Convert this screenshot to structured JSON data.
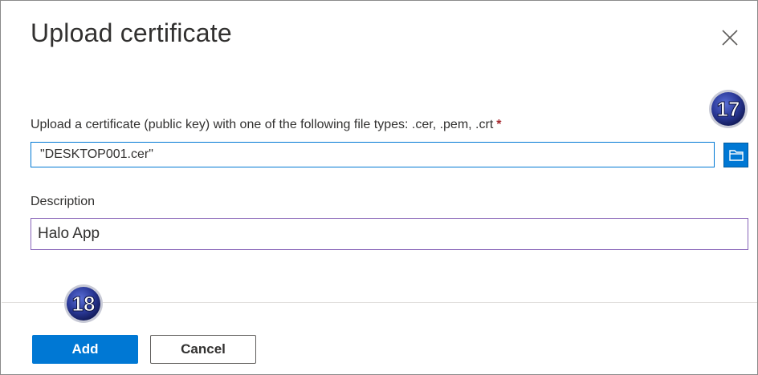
{
  "dialog": {
    "title": "Upload certificate"
  },
  "upload": {
    "label": "Upload a certificate (public key) with one of the following file types: .cer, .pem, .crt",
    "required_marker": "*",
    "file_value": "\"DESKTOP001.cer\""
  },
  "description": {
    "label": "Description",
    "value": "Halo App"
  },
  "callouts": {
    "step_a": "17",
    "step_b": "18"
  },
  "actions": {
    "add_label": "Add",
    "cancel_label": "Cancel"
  },
  "icons": {
    "close": "close-icon",
    "browse": "folder-icon"
  },
  "colors": {
    "accent": "#0078d4",
    "focus_border": "#8764b8",
    "required": "#a4262c",
    "badge": "#2b3a9a"
  }
}
